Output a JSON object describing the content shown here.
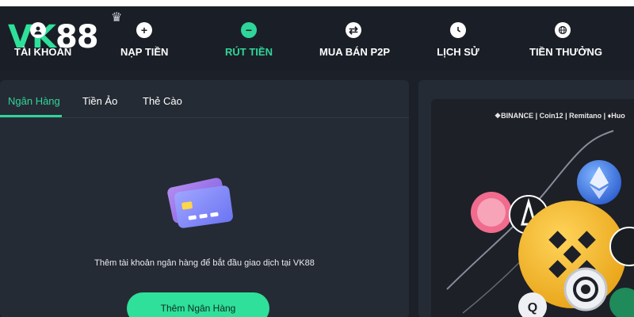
{
  "brand": {
    "logo_prefix": "VK",
    "logo_suffix": "88",
    "accent": "#2fe09a",
    "background": "#1c2129",
    "panel": "#252b34"
  },
  "nav": {
    "items": [
      {
        "label": "TÀI KHOẢN",
        "icon": "user-icon",
        "active": false
      },
      {
        "label": "NẠP TIỀN",
        "icon": "plus-circle-icon",
        "active": false
      },
      {
        "label": "RÚT TIỀN",
        "icon": "minus-circle-icon",
        "active": true
      },
      {
        "label": "MUA BÁN P2P",
        "icon": "swap-icon",
        "active": false
      },
      {
        "label": "LỊCH SỬ",
        "icon": "clock-icon",
        "active": false
      },
      {
        "label": "TIỀN THƯỞNG",
        "icon": "globe-icon",
        "active": false
      }
    ]
  },
  "withdraw": {
    "tabs": [
      {
        "label": "Ngân Hàng",
        "active": true
      },
      {
        "label": "Tiền Ảo",
        "active": false
      },
      {
        "label": "Thẻ Cào",
        "active": false
      }
    ],
    "empty_state_text": "Thêm tài khoản ngân hàng để bắt đầu giao dịch tại VK88",
    "add_bank_button": "Thêm Ngân Hàng"
  },
  "promo": {
    "partners": "❖BINANCE | Coin12 | Remitano | ♦Huo"
  }
}
